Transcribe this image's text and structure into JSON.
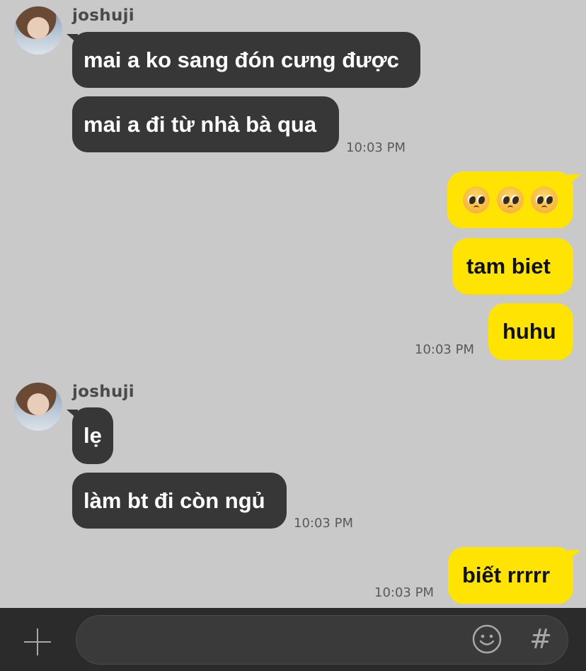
{
  "conversation": {
    "groups": [
      {
        "sender": "joshuji",
        "messages": [
          "mai a ko sang đón cưng được",
          "mai a đi từ nhà bà qua"
        ],
        "time": "10:03 PM"
      },
      {
        "emoji_message": "🥺🥺🥺",
        "messages": [
          "tam biet",
          "huhu"
        ],
        "time": "10:03 PM"
      },
      {
        "sender": "joshuji",
        "messages": [
          "lẹ",
          "làm bt đi còn ngủ"
        ],
        "time": "10:03 PM"
      },
      {
        "messages": [
          "biết rrrrr"
        ],
        "time": "10:03 PM"
      }
    ]
  },
  "composer": {
    "placeholder": "",
    "hash_label": "#"
  },
  "colors": {
    "background": "#c9c9c9",
    "incoming_bubble": "#373737",
    "outgoing_bubble": "#ffe403",
    "composer_bar": "#2b2b2b"
  },
  "icons": {
    "add": "plus-icon",
    "emoji": "smiley-icon",
    "hashtag": "hash-icon"
  }
}
